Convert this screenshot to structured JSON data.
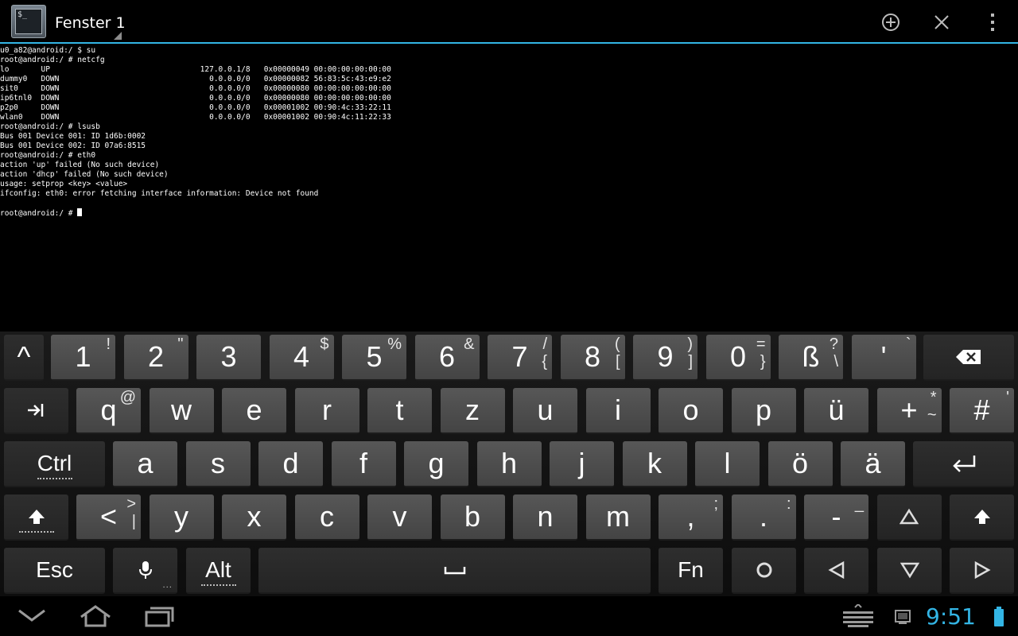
{
  "window": {
    "title": "Fenster 1",
    "icon": "terminal-app-icon",
    "icon_text": "$_"
  },
  "actionbar": {
    "new_window": "plus-circle-icon",
    "close_window": "close-icon",
    "overflow": "overflow-menu-icon"
  },
  "terminal": {
    "lines": [
      "u0_a82@android:/ $ su",
      "root@android:/ # netcfg",
      "lo       UP                                 127.0.0.1/8   0x00000049 00:00:00:00:00:00",
      "dummy0   DOWN                                 0.0.0.0/0   0x00000082 56:83:5c:43:e9:e2",
      "sit0     DOWN                                 0.0.0.0/0   0x00000080 00:00:00:00:00:00",
      "ip6tnl0  DOWN                                 0.0.0.0/0   0x00000080 00:00:00:00:00:00",
      "p2p0     DOWN                                 0.0.0.0/0   0x00001002 00:90:4c:33:22:11",
      "wlan0    DOWN                                 0.0.0.0/0   0x00001002 00:90:4c:11:22:33",
      "root@android:/ # lsusb",
      "Bus 001 Device 001: ID 1d6b:0002",
      "Bus 001 Device 002: ID 07a6:8515",
      "root@android:/ # eth0",
      "action 'up' failed (No such device)",
      "action 'dhcp' failed (No such device)",
      "usage: setprop <key> <value>",
      "ifconfig: eth0: error fetching interface information: Device not found",
      ""
    ],
    "prompt": "root@android:/ # "
  },
  "keyboard": {
    "rows": [
      [
        {
          "main": "^",
          "dark": true
        },
        {
          "main": "1",
          "top": "!"
        },
        {
          "main": "2",
          "top": "\""
        },
        {
          "main": "3"
        },
        {
          "main": "4",
          "top": "$"
        },
        {
          "main": "5",
          "top": "%"
        },
        {
          "main": "6",
          "top": "&"
        },
        {
          "main": "7",
          "top": "/",
          "bot": "{"
        },
        {
          "main": "8",
          "top": "(",
          "bot": "["
        },
        {
          "main": "9",
          "top": ")",
          "bot": "]"
        },
        {
          "main": "0",
          "top": "=",
          "bot": "}"
        },
        {
          "main": "ß",
          "top": "?",
          "bot": "\\"
        },
        {
          "main": "'",
          "top": "`"
        },
        {
          "icon": "backspace-icon",
          "dark": true
        }
      ],
      [
        {
          "icon": "tab-icon",
          "dark": true
        },
        {
          "main": "q",
          "top": "@"
        },
        {
          "main": "w"
        },
        {
          "main": "e"
        },
        {
          "main": "r"
        },
        {
          "main": "t"
        },
        {
          "main": "z"
        },
        {
          "main": "u"
        },
        {
          "main": "i"
        },
        {
          "main": "o"
        },
        {
          "main": "p"
        },
        {
          "main": "ü"
        },
        {
          "main": "+",
          "top": "*",
          "bot": "~"
        },
        {
          "main": "#",
          "top": "'"
        }
      ],
      [
        {
          "main": "Ctrl",
          "dark": true,
          "word": true,
          "underline": true
        },
        {
          "main": "a"
        },
        {
          "main": "s"
        },
        {
          "main": "d"
        },
        {
          "main": "f"
        },
        {
          "main": "g"
        },
        {
          "main": "h"
        },
        {
          "main": "j"
        },
        {
          "main": "k"
        },
        {
          "main": "l"
        },
        {
          "main": "ö"
        },
        {
          "main": "ä"
        },
        {
          "icon": "enter-icon",
          "dark": true
        }
      ],
      [
        {
          "icon": "shift-icon",
          "dark": true,
          "underline": true
        },
        {
          "main": "<",
          "top": ">",
          "bot": "|"
        },
        {
          "main": "y"
        },
        {
          "main": "x"
        },
        {
          "main": "c"
        },
        {
          "main": "v"
        },
        {
          "main": "b"
        },
        {
          "main": "n"
        },
        {
          "main": "m"
        },
        {
          "main": ",",
          "top": ";"
        },
        {
          "main": ".",
          "top": ":"
        },
        {
          "main": "-",
          "top": "_"
        },
        {
          "icon": "arrow-up-icon",
          "dark": true
        },
        {
          "icon": "shift-icon",
          "dark": true
        }
      ],
      [
        {
          "main": "Esc",
          "dark": true,
          "word": true
        },
        {
          "icon": "microphone-icon",
          "dark": true,
          "dots": "..."
        },
        {
          "main": "Alt",
          "dark": true,
          "word": true,
          "underline": true
        },
        {
          "icon": "space-icon",
          "dark": true
        },
        {
          "main": "Fn",
          "dark": true,
          "word": true
        },
        {
          "icon": "circle-icon",
          "dark": true
        },
        {
          "icon": "arrow-left-icon",
          "dark": true
        },
        {
          "icon": "arrow-down-icon",
          "dark": true
        },
        {
          "icon": "arrow-right-icon",
          "dark": true
        }
      ]
    ]
  },
  "systembar": {
    "back": "back-icon",
    "home": "home-icon",
    "recents": "recent-apps-icon",
    "keyboard": "keyboard-icon",
    "notification": "notification-icon",
    "clock": "9:51",
    "battery": "battery-icon",
    "accent_color": "#33b5e5"
  }
}
